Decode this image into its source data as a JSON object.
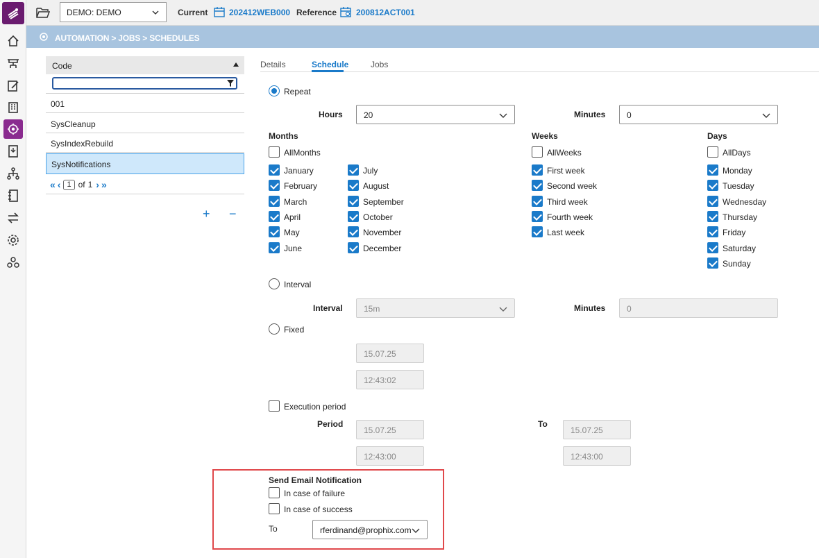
{
  "topbar": {
    "database": "DEMO: DEMO",
    "current_label": "Current",
    "current_value": "202412WEB000",
    "reference_label": "Reference",
    "reference_value": "200812ACT001"
  },
  "breadcrumb": "AUTOMATION > JOBS > SCHEDULES",
  "list": {
    "column": "Code",
    "rows": [
      "001",
      "SysCleanup",
      "SysIndexRebuild",
      "SysNotifications"
    ],
    "selected_index": 3,
    "pager": {
      "page": "1",
      "of_label": "of",
      "total": "1"
    }
  },
  "tabs": [
    "Details",
    "Schedule",
    "Jobs"
  ],
  "schedule": {
    "repeat_label": "Repeat",
    "hours_label": "Hours",
    "hours_value": "20",
    "minutes_label": "Minutes",
    "minutes_value": "0",
    "months_title": "Months",
    "all_months": "AllMonths",
    "months": [
      "January",
      "February",
      "March",
      "April",
      "May",
      "June",
      "July",
      "August",
      "September",
      "October",
      "November",
      "December"
    ],
    "weeks_title": "Weeks",
    "all_weeks": "AllWeeks",
    "weeks": [
      "First week",
      "Second week",
      "Third week",
      "Fourth week",
      "Last week"
    ],
    "days_title": "Days",
    "all_days": "AllDays",
    "days": [
      "Monday",
      "Tuesday",
      "Wednesday",
      "Thursday",
      "Friday",
      "Saturday",
      "Sunday"
    ],
    "interval_label": "Interval",
    "interval_field_label": "Interval",
    "interval_value": "15m",
    "interval_minutes_label": "Minutes",
    "interval_minutes_value": "0",
    "fixed_label": "Fixed",
    "fixed_date": "15.07.25",
    "fixed_time": "12:43:02",
    "execution_period_label": "Execution period",
    "period_label": "Period",
    "period_from_date": "15.07.25",
    "period_from_time": "12:43:00",
    "to_label": "To",
    "period_to_date": "15.07.25",
    "period_to_time": "12:43:00"
  },
  "email": {
    "title": "Send Email Notification",
    "failure_label": "In case of failure",
    "success_label": "In case of success",
    "to_label": "To",
    "to_value": "rferdinand@prophix.com"
  },
  "colors": {
    "accent": "#1a7ac9",
    "brand": "#6a1b6f",
    "band": "#a8c4df",
    "highlight": "#e0484b"
  }
}
